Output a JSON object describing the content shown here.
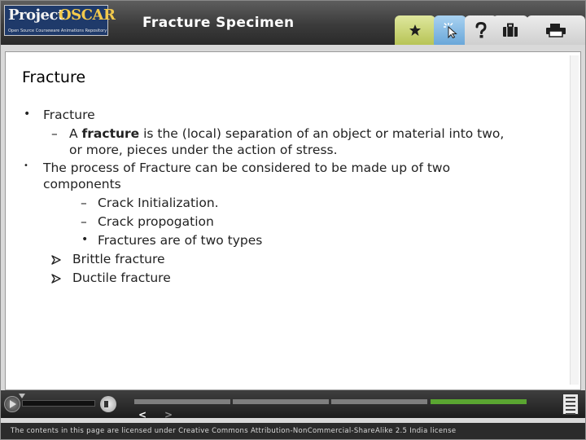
{
  "header": {
    "logo_project": "Project",
    "logo_oscar": "OSCAR",
    "logo_tagline": "Open Source Courseware Animations Repository",
    "title": "Fracture Specimen"
  },
  "toolbar": {
    "tabs": [
      {
        "name": "star",
        "icon": "star-icon"
      },
      {
        "name": "pointer",
        "icon": "pointer-click-icon"
      },
      {
        "name": "help",
        "icon": "question-icon"
      },
      {
        "name": "kit",
        "icon": "briefcase-icon"
      },
      {
        "name": "print",
        "icon": "printer-icon"
      }
    ],
    "colors": {
      "star_tab": "#c8d46e",
      "pointer_tab": "#7fb5e0"
    }
  },
  "slide": {
    "heading": "Fracture",
    "item1": "Fracture",
    "sub1_dash": "–",
    "sub1_pre": "A ",
    "sub1_bold": "fracture",
    "sub1_post": " is the (local) separation of an object or material into two,",
    "sub1_cont": "or more, pieces under the action of stress.",
    "item2_line1": "The process of Fracture can be considered to be made up of two",
    "item2_line2": "components",
    "sub2": "Crack Initialization.",
    "sub3": "Crack propogation",
    "sub4": "Fractures are of two types",
    "types": [
      "Brittle fracture",
      "Ductile fracture"
    ]
  },
  "player": {
    "progress": {
      "segments": 4,
      "current": 4
    },
    "progress_color": "#5aa531",
    "prev_label": "<",
    "next_label": ">"
  },
  "footer": {
    "license": "The contents in this page are licensed under Creative Commons Attribution-NonCommercial-ShareAlike 2.5 India license"
  }
}
